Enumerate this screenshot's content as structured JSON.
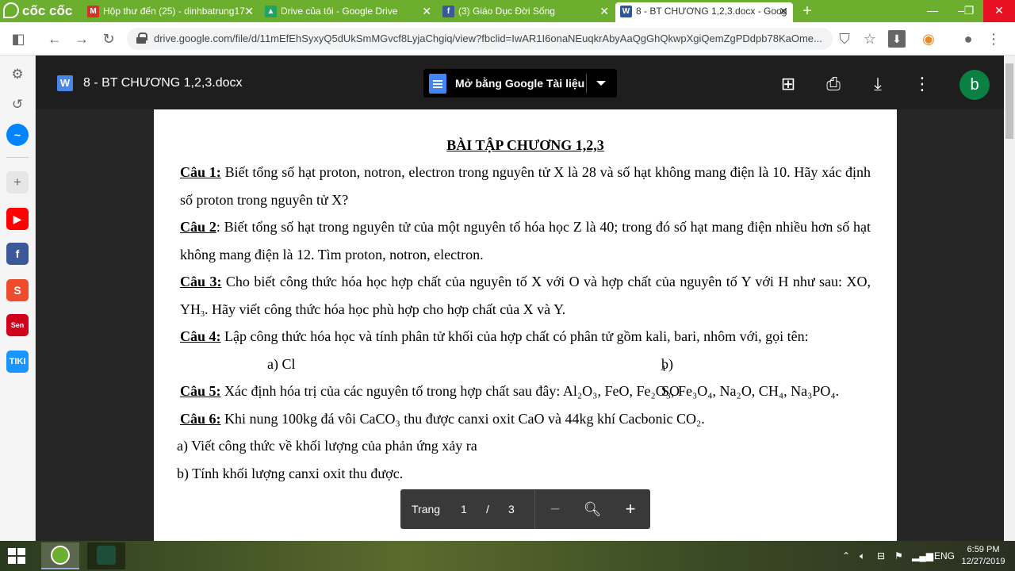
{
  "browser": {
    "brand": "cốc cốc",
    "tabs": [
      {
        "title": "Hộp thư đến (25) - dinhbatrung17",
        "icon": "gmail-icon"
      },
      {
        "title": "Drive của tôi - Google Drive",
        "icon": "drive-icon"
      },
      {
        "title": "(3) Giáo Dục Đời Sống",
        "icon": "facebook-icon"
      },
      {
        "title": "8 - BT CHƯƠNG 1,2,3.docx - Goog",
        "icon": "word-icon"
      }
    ],
    "new_tab": "+",
    "url": "drive.google.com/file/d/11mEfEhSyxyQ5dUkSmMGvcf8LyjaChgiq/view?fbclid=IwAR1I6onaNEuqkrAbyAaQgGhQkwpXgiQemZgPDdpb78KaOme..."
  },
  "viewer": {
    "file_icon": "W",
    "title": "8 - BT CHƯƠNG 1,2,3.docx",
    "open_with": "Mở bằng Google Tài liệu",
    "avatar": "b"
  },
  "document": {
    "heading": "BÀI TẬP CHƯƠNG 1,2,3",
    "q1_label": "Câu 1:",
    "q1_text": " Biết tổng số hạt proton, notron, electron trong nguyên tử X là 28 và số hạt không mang điện là 10. Hãy xác định số proton trong nguyên tử X?",
    "q2_label": "Câu 2",
    "q2_text": ": Biết tổng số hạt trong nguyên tử của một nguyên tố hóa học Z là 40; trong đó số hạt mang điện nhiều hơn số hạt không mang điện là 12. Tìm proton, notron, electron.",
    "q3_label": "Câu 3:",
    "q3_text_a": " Cho biết công thức hóa học hợp chất của nguyên tố X với O và hợp chất của nguyên tố Y với H như sau: XO, YH",
    "q3_sub": "3",
    "q3_text_b": ". Hãy viết công thức hóa học phù hợp cho hợp chất của X và Y.",
    "q4_label": "Câu 4:",
    "q4_text": " Lập công thức hóa học và tính phân tử khối của hợp chất có phân tử gồm kali, bari, nhôm với, gọi tên:",
    "q4_opt_a": "a) Cl",
    "q4_opt_b": "b) SO",
    "q4_opt_b_sub": "4",
    "q5_label": "Câu 5:",
    "q5_text": " Xác định hóa trị của các nguyên tố trong hợp chất sau đây: Al₂O₃, FeO, Fe₂O₃, Fe₃O₄, Na₂O, CH₄, Na₃PO₄.",
    "q6_label": "Câu 6:",
    "q6_text": " Khi nung 100kg đá vôi CaCO₃ thu được canxi oxit CaO và 44kg khí Cacbonic CO₂.",
    "q6_a": "a) Viết công thức về khối lượng của phản ứng xảy ra",
    "q6_b": "b) Tính khối lượng canxi oxit thu được."
  },
  "pager": {
    "label": "Trang",
    "current": "1",
    "separator": "/",
    "total": "3"
  },
  "taskbar": {
    "language": "ENG",
    "time": "6:59 PM",
    "date": "12/27/2019"
  },
  "colors": {
    "browser_accent": "#6cae2e",
    "viewer_bg": "#262626",
    "avatar_bg": "#0b8043",
    "docs_blue": "#4285f4"
  }
}
